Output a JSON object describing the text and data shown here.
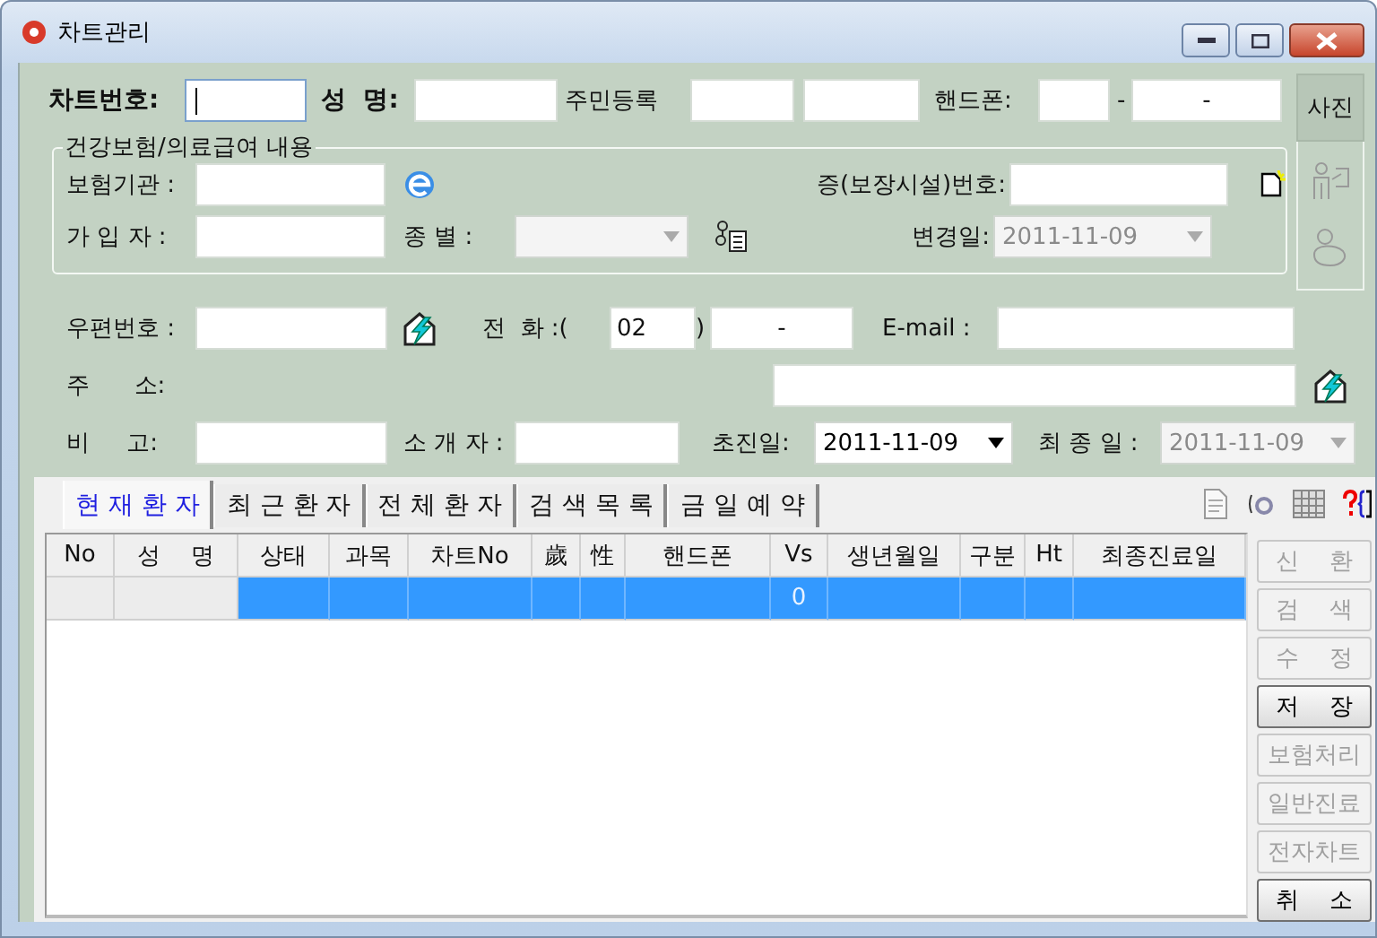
{
  "window": {
    "title": "차트관리"
  },
  "top_row": {
    "chart_no_label": "차트번호:",
    "name_label": "성  명:",
    "resident_label": "주민등록",
    "mobile_label": "핸드폰:",
    "mobile_separator": "-",
    "mobile_rest": "-"
  },
  "photo_panel": {
    "label": "사진"
  },
  "insurance": {
    "legend": "건강보험/의료급여 내용",
    "insurer_label": "보험기관 :",
    "subscriber_label": "가 입 자 :",
    "type_label": "종 별 :",
    "type_combo": {
      "disabled": true
    },
    "card_no_label": "증(보장시설)번호:",
    "changed": {
      "label": "변경일:",
      "value": "2011-11-09",
      "disabled": true
    }
  },
  "contact": {
    "zip_label": "우편번호 :",
    "phone_label": "전  화 :(",
    "phone_area": "02",
    "phone_close": ")",
    "phone_number": "-",
    "email_label": "E-mail :",
    "address_label": "주      소:",
    "memo_label": "비     고:",
    "referrer_label": "소 개 자 :",
    "first_visit": {
      "label": "초진일:",
      "value": "2011-11-09",
      "disabled": false
    },
    "last_visit": {
      "label": "최 종 일 :",
      "value": "2011-11-09",
      "disabled": true
    }
  },
  "tabs": [
    {
      "label": "현 재 환 자",
      "selected": true
    },
    {
      "label": "최 근 환 자",
      "selected": false
    },
    {
      "label": "전 체 환 자",
      "selected": false
    },
    {
      "label": "검 색 목 록",
      "selected": false
    },
    {
      "label": "금 일 예 약",
      "selected": false
    }
  ],
  "grid": {
    "columns": [
      {
        "label": "No",
        "frozen": true
      },
      {
        "label": "성    명",
        "frozen": true
      },
      {
        "label": "상태",
        "frozen": false
      },
      {
        "label": "과목",
        "frozen": false
      },
      {
        "label": "차트No",
        "frozen": false
      },
      {
        "label": "歲",
        "frozen": false
      },
      {
        "label": "性",
        "frozen": false
      },
      {
        "label": "핸드폰",
        "frozen": false
      },
      {
        "label": "Vs",
        "frozen": false
      },
      {
        "label": "생년월일",
        "frozen": false
      },
      {
        "label": "구분",
        "frozen": false
      },
      {
        "label": "Ht",
        "frozen": false
      },
      {
        "label": "최종진료일",
        "frozen": false
      }
    ],
    "rows": [
      {
        "selected": true,
        "vs": "0"
      }
    ]
  },
  "buttons": [
    {
      "label": "신    환",
      "disabled": true
    },
    {
      "label": "검    색",
      "disabled": true
    },
    {
      "label": "수    정",
      "disabled": true
    },
    {
      "label": "저    장",
      "disabled": false
    },
    {
      "label": "보험처리",
      "disabled": true
    },
    {
      "label": "일반진료",
      "disabled": true
    },
    {
      "label": "전자차트",
      "disabled": true
    },
    {
      "label": "취    소",
      "disabled": false
    }
  ]
}
